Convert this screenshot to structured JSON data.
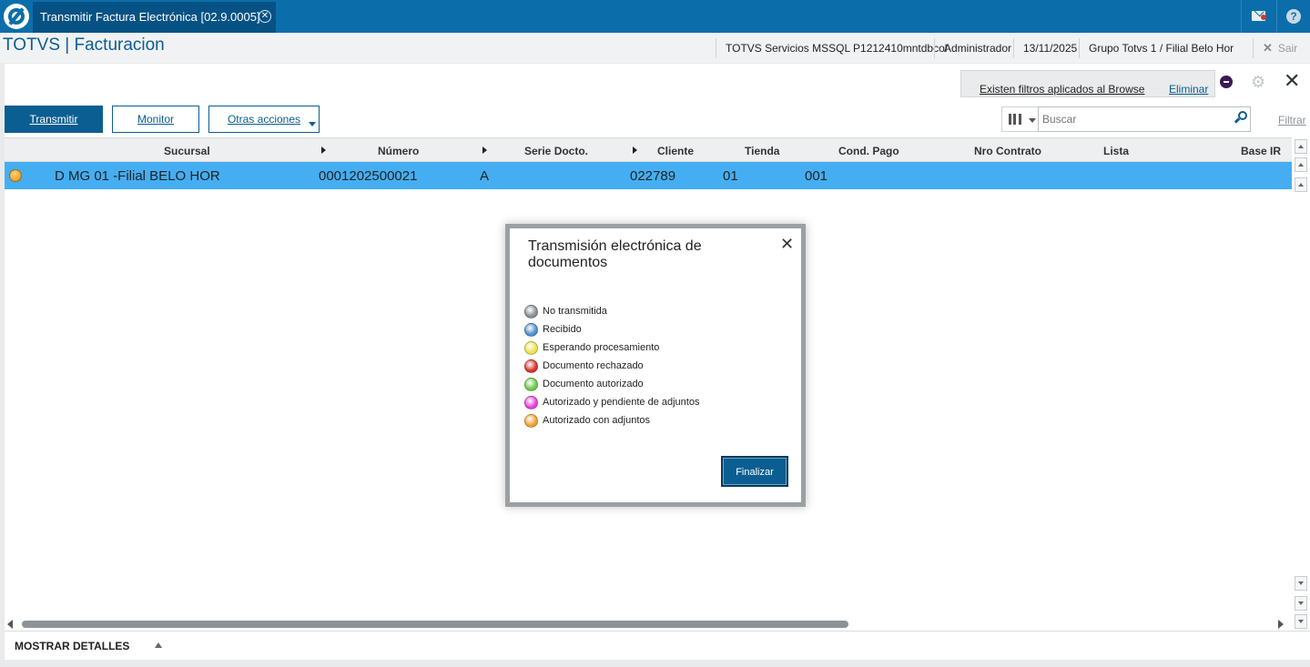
{
  "topbar": {
    "tab_label": "Transmitir Factura Electrónica [02.9.0005]",
    "tab_close": "✕",
    "help_glyph": "?"
  },
  "header": {
    "title": "TOTVS | Facturacion",
    "environment": "TOTVS Servicios MSSQL P1212410mntdbcol",
    "user": "Administrador",
    "date": "13/11/2025",
    "company": "Grupo Totvs 1 / Filial Belo Hor",
    "logout_label": "Sair",
    "logout_glyph": "✕"
  },
  "filters": {
    "notice": "Existen filtros aplicados al Browse",
    "remove_label": "Eliminar"
  },
  "toolbar": {
    "transmit_label": "Transmitir",
    "monitor_label": "Monitor",
    "more_label": "Otras acciones",
    "search_placeholder": "Buscar",
    "filter_label": "Filtrar"
  },
  "grid": {
    "columns": [
      "Sucursal",
      "Número",
      "Serie Docto.",
      "Cliente",
      "Tienda",
      "Cond. Pago",
      "Nro Contrato",
      "Lista",
      "Base IR"
    ],
    "rows": [
      {
        "status_color": "#f0a030",
        "sucursal": "D MG 01 -Filial BELO HOR",
        "numero": "0001202500021",
        "serie": "A",
        "cliente": "022789",
        "tienda": "01",
        "cond_pago": "001"
      }
    ]
  },
  "details": {
    "label": "MOSTRAR DETALLES"
  },
  "modal": {
    "title": "Transmisión electrónica de documentos",
    "close_glyph": "✕",
    "legend": [
      {
        "label": "No transmitida",
        "color": "#8a8f93"
      },
      {
        "label": "Recibido",
        "color": "#4f8fd0"
      },
      {
        "label": "Esperando procesamiento",
        "color": "#eee24a"
      },
      {
        "label": "Documento rechazado",
        "color": "#d8332e"
      },
      {
        "label": "Documento autorizado",
        "color": "#6cc84a"
      },
      {
        "label": "Autorizado y pendiente de adjuntos",
        "color": "#e540d8"
      },
      {
        "label": "Autorizado con adjuntos",
        "color": "#f0a030"
      }
    ],
    "finish_label": "Finalizar"
  },
  "colors": {
    "brand": "#0b6eaa",
    "selected_row": "#45aef2"
  }
}
